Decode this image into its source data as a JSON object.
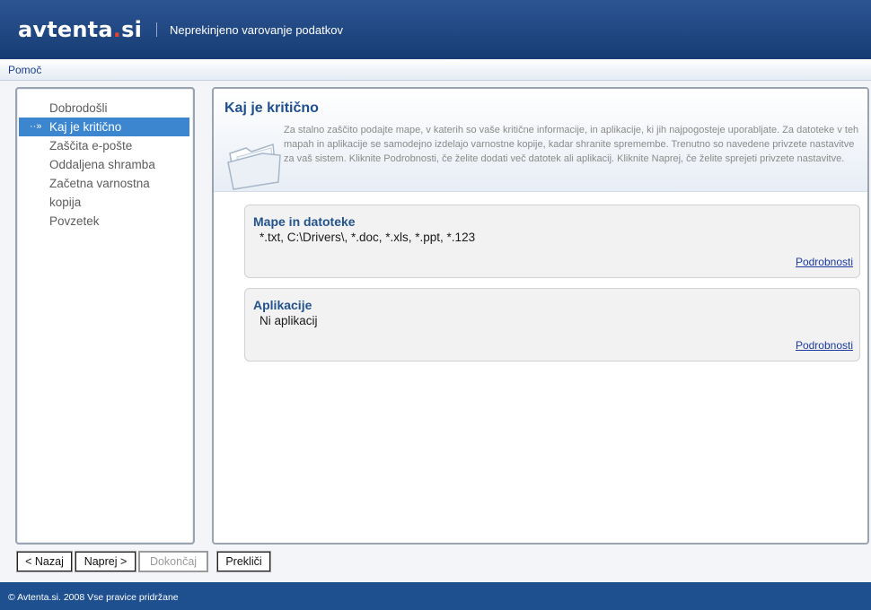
{
  "header": {
    "logo_main": "avtenta",
    "logo_dot": ".",
    "logo_tld": "si",
    "tagline": "Neprekinjeno varovanje podatkov"
  },
  "menubar": {
    "help_label": "Pomoč"
  },
  "sidebar": {
    "items": [
      {
        "label": "Dobrodošli",
        "active": false
      },
      {
        "label": "Kaj je kritično",
        "active": true
      },
      {
        "label": "Zaščita e-pošte",
        "active": false
      },
      {
        "label": "Oddaljena shramba",
        "active": false
      },
      {
        "label": "Začetna varnostna",
        "active": false
      },
      {
        "label": "kopija",
        "active": false
      },
      {
        "label": "Povzetek",
        "active": false
      }
    ],
    "active_arrow": "··»"
  },
  "main": {
    "title": "Kaj je kritično",
    "description": "Za stalno zaščito podajte mape, v katerih so vaše kritične informacije, in aplikacije, ki jih najpogosteje uporabljate. Za datoteke v teh mapah in aplikacije se samodejno izdelajo varnostne kopije, kadar shranite spremembe. Trenutno so navedene privzete nastavitve za vaš sistem. Kliknite Podrobnosti, če želite dodati več datotek ali aplikacij. Kliknite Naprej, če želite sprejeti privzete nastavitve.",
    "groups": [
      {
        "title": "Mape in datoteke",
        "value": "*.txt, C:\\Drivers\\, *.doc, *.xls, *.ppt, *.123",
        "link": "Podrobnosti"
      },
      {
        "title": "Aplikacije",
        "value": "Ni aplikacij",
        "link": "Podrobnosti"
      }
    ]
  },
  "buttons": {
    "back": "< Nazaj",
    "next": "Naprej >",
    "finish": "Dokončaj",
    "cancel": "Prekliči"
  },
  "footer": {
    "text": "© Avtenta.si. 2008 Vse pravice pridržane"
  },
  "colors": {
    "header_bg": "#1f477f",
    "accent_active": "#3b86cf",
    "title_blue": "#1f4f8f",
    "footer_bg": "#1e4f8e",
    "logo_dot": "#e3432f"
  }
}
